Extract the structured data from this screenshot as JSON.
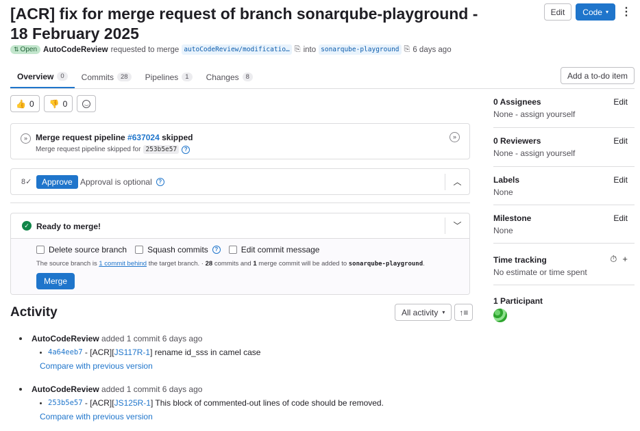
{
  "header": {
    "title": "[ACR] fix for merge request of branch sonarqube-playground - 18 February 2025",
    "edit_label": "Edit",
    "code_label": "Code",
    "status_badge": "Open",
    "author": "AutoCodeReview",
    "requested_text": "requested to merge",
    "source_branch": "autoCodeReview/modificatio…",
    "into_text": "into",
    "target_branch": "sonarqube-playground",
    "time_ago": "6 days ago"
  },
  "tabs": [
    {
      "label": "Overview",
      "count": "0"
    },
    {
      "label": "Commits",
      "count": "28"
    },
    {
      "label": "Pipelines",
      "count": "1"
    },
    {
      "label": "Changes",
      "count": "8"
    }
  ],
  "todo_label": "Add a to-do item",
  "reactions": {
    "thumbs_up": "0",
    "thumbs_down": "0"
  },
  "pipeline": {
    "title_prefix": "Merge request pipeline",
    "pipeline_id": "#637024",
    "status": "skipped",
    "subtitle": "Merge request pipeline skipped for",
    "sha": "253b5e57"
  },
  "approval": {
    "button": "Approve",
    "text": "Approval is optional"
  },
  "merge": {
    "ready_text": "Ready to merge!",
    "opt_delete": "Delete source branch",
    "opt_squash": "Squash commits",
    "opt_edit": "Edit commit message",
    "note_prefix": "The source branch is",
    "note_link": "1 commit behind",
    "note_mid": "the target branch. ·",
    "note_commits": "28",
    "note_commits_text": "commits and",
    "note_merge": "1",
    "note_suffix": "merge commit will be added to",
    "note_branch": "sonarqube-playground",
    "note_end": ".",
    "button": "Merge"
  },
  "activity": {
    "title": "Activity",
    "filter": "All activity",
    "items": [
      {
        "author": "AutoCodeReview",
        "text": "added 1 commit 6 days ago",
        "sha": "4a64eeb7",
        "msg_prefix": "- [ACR][",
        "ticket": "JS117R-1",
        "msg_suffix": "] rename id_sss in camel case",
        "compare": "Compare with previous version"
      },
      {
        "author": "AutoCodeReview",
        "text": "added 1 commit 6 days ago",
        "sha": "253b5e57",
        "msg_prefix": "- [ACR][",
        "ticket": "JS125R-1",
        "msg_suffix": "] This block of commented-out lines of code should be removed.",
        "compare": "Compare with previous version"
      }
    ]
  },
  "sidebar": {
    "assignees_title": "0 Assignees",
    "assignees_val": "None - assign yourself",
    "reviewers_title": "0 Reviewers",
    "reviewers_val": "None - assign yourself",
    "labels_title": "Labels",
    "labels_val": "None",
    "milestone_title": "Milestone",
    "milestone_val": "None",
    "time_title": "Time tracking",
    "time_val": "No estimate or time spent",
    "participants_title": "1 Participant",
    "edit_label": "Edit"
  },
  "colors": {
    "primary": "#1f75cb",
    "success": "#108548",
    "open_badge_bg": "#c3e6cd"
  }
}
